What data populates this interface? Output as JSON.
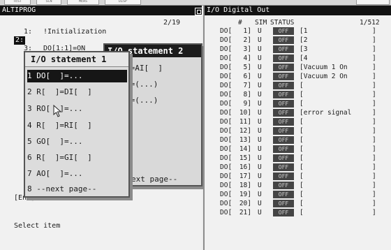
{
  "top_tabs": [
    "TEST",
    "SCN",
    "MEAS",
    "DISP"
  ],
  "left_window": {
    "title": "ALTIPROG",
    "page_indicator": "2/19",
    "lines": [
      {
        "num": "1:",
        "text": "!Initialization"
      },
      {
        "num": "2:",
        "text": ""
      },
      {
        "num": "3:",
        "text": "DO[1:1]=ON"
      }
    ],
    "end_marker": "[End]",
    "prompt": "Select item"
  },
  "popup_back": {
    "title": "I/O statement  2",
    "items": [
      "]=AI[  ]",
      "]=(...)",
      "]=(...)",
      "ext page--"
    ]
  },
  "popup_front": {
    "title": "I/O statement  1",
    "items": [
      {
        "label": "1 DO[  ]=..."
      },
      {
        "label": "2 R[  ]=DI[  ]"
      },
      {
        "label": "3 RO[  ]=..."
      },
      {
        "label": "4 R[  ]=RI[  ]"
      },
      {
        "label": "5 GO[  ]=..."
      },
      {
        "label": "6 R[  ]=GI[  ]"
      },
      {
        "label": "7 AO[  ]=..."
      },
      {
        "label": "8 --next page--"
      }
    ],
    "selected_index": 0
  },
  "right_window": {
    "title": "I/O Digital Out",
    "header": {
      "num": "#",
      "sim": "SIM",
      "status": "STATUS",
      "page": "1/512"
    },
    "rows": [
      {
        "port": "DO[",
        "idx": "1]",
        "sim": "U",
        "status": "OFF",
        "comment": "[1"
      },
      {
        "port": "DO[",
        "idx": "2]",
        "sim": "U",
        "status": "OFF",
        "comment": "[2"
      },
      {
        "port": "DO[",
        "idx": "3]",
        "sim": "U",
        "status": "OFF",
        "comment": "[3"
      },
      {
        "port": "DO[",
        "idx": "4]",
        "sim": "U",
        "status": "OFF",
        "comment": "[4"
      },
      {
        "port": "DO[",
        "idx": "5]",
        "sim": "U",
        "status": "OFF",
        "comment": "[Vacuum 1 On"
      },
      {
        "port": "DO[",
        "idx": "6]",
        "sim": "U",
        "status": "OFF",
        "comment": "[Vacuum 2 On"
      },
      {
        "port": "DO[",
        "idx": "7]",
        "sim": "U",
        "status": "OFF",
        "comment": "["
      },
      {
        "port": "DO[",
        "idx": "8]",
        "sim": "U",
        "status": "OFF",
        "comment": "["
      },
      {
        "port": "DO[",
        "idx": "9]",
        "sim": "U",
        "status": "OFF",
        "comment": "["
      },
      {
        "port": "DO[",
        "idx": "10]",
        "sim": "U",
        "status": "OFF",
        "comment": "[error signal"
      },
      {
        "port": "DO[",
        "idx": "11]",
        "sim": "U",
        "status": "OFF",
        "comment": "["
      },
      {
        "port": "DO[",
        "idx": "12]",
        "sim": "U",
        "status": "OFF",
        "comment": "["
      },
      {
        "port": "DO[",
        "idx": "13]",
        "sim": "U",
        "status": "OFF",
        "comment": "["
      },
      {
        "port": "DO[",
        "idx": "14]",
        "sim": "U",
        "status": "OFF",
        "comment": "["
      },
      {
        "port": "DO[",
        "idx": "15]",
        "sim": "U",
        "status": "OFF",
        "comment": "["
      },
      {
        "port": "DO[",
        "idx": "16]",
        "sim": "U",
        "status": "OFF",
        "comment": "["
      },
      {
        "port": "DO[",
        "idx": "17]",
        "sim": "U",
        "status": "OFF",
        "comment": "["
      },
      {
        "port": "DO[",
        "idx": "18]",
        "sim": "U",
        "status": "OFF",
        "comment": "["
      },
      {
        "port": "DO[",
        "idx": "19]",
        "sim": "U",
        "status": "OFF",
        "comment": "["
      },
      {
        "port": "DO[",
        "idx": "20]",
        "sim": "U",
        "status": "OFF",
        "comment": "["
      },
      {
        "port": "DO[",
        "idx": "21]",
        "sim": "U",
        "status": "OFF",
        "comment": "["
      }
    ],
    "close_bracket": "]"
  },
  "icons": {
    "maximize": "maximize-icon",
    "cursor": "mouse-pointer-icon"
  }
}
